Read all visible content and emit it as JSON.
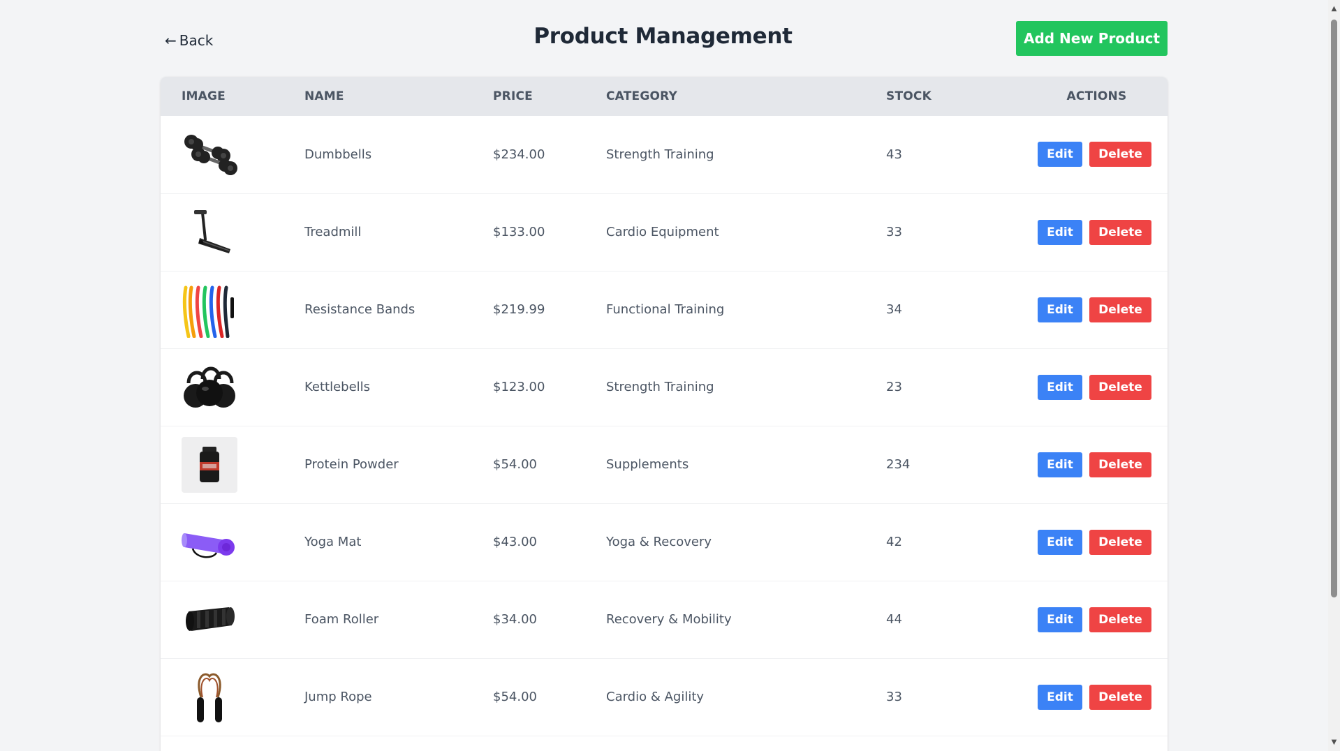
{
  "header": {
    "back_label": "Back",
    "back_arrow": "←",
    "title": "Product Management",
    "add_button_label": "Add New Product"
  },
  "table": {
    "columns": [
      "IMAGE",
      "NAME",
      "PRICE",
      "CATEGORY",
      "STOCK",
      "ACTIONS"
    ],
    "rows": [
      {
        "image": "dumbbells-image",
        "name": "Dumbbells",
        "price": "$234.00",
        "category": "Strength Training",
        "stock": "43"
      },
      {
        "image": "treadmill-image",
        "name": "Treadmill",
        "price": "$133.00",
        "category": "Cardio Equipment",
        "stock": "33"
      },
      {
        "image": "resistance-bands-image",
        "name": "Resistance Bands",
        "price": "$219.99",
        "category": "Functional Training",
        "stock": "34"
      },
      {
        "image": "kettlebells-image",
        "name": "Kettlebells",
        "price": "$123.00",
        "category": "Strength Training",
        "stock": "23"
      },
      {
        "image": "protein-powder-image",
        "name": "Protein Powder",
        "price": "$54.00",
        "category": "Supplements",
        "stock": "234"
      },
      {
        "image": "yoga-mat-image",
        "name": "Yoga Mat",
        "price": "$43.00",
        "category": "Yoga & Recovery",
        "stock": "42"
      },
      {
        "image": "foam-roller-image",
        "name": "Foam Roller",
        "price": "$34.00",
        "category": "Recovery & Mobility",
        "stock": "44"
      },
      {
        "image": "jump-rope-image",
        "name": "Jump Rope",
        "price": "$54.00",
        "category": "Cardio & Agility",
        "stock": "33"
      }
    ],
    "edit_label": "Edit",
    "delete_label": "Delete"
  },
  "colors": {
    "background": "#f3f4f6",
    "add_button": "#22c55e",
    "edit_button": "#3b82f6",
    "delete_button": "#ef4444",
    "header_row": "#e5e7eb"
  }
}
